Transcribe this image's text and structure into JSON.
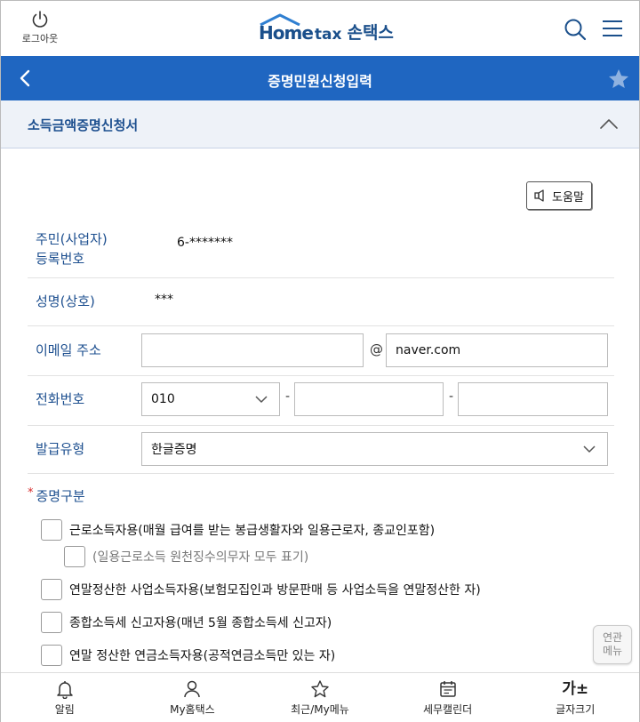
{
  "header": {
    "logout_label": "로그아웃",
    "logo_home": "Home",
    "logo_tax": "tax",
    "logo_korean": "손택스",
    "brand_color": "#1a4f8b",
    "accent_color": "#f29a1f"
  },
  "titlebar": {
    "title": "증명민원신청입력",
    "background": "#1f66c1"
  },
  "section": {
    "title": "소득금액증명신청서"
  },
  "help_button": {
    "label": "도움말"
  },
  "form": {
    "resident_number": {
      "label_line1": "주민(사업자)",
      "label_line2": "등록번호",
      "value": "6-*******"
    },
    "name": {
      "label": "성명(상호)",
      "value": "***"
    },
    "email": {
      "label": "이메일 주소",
      "local_value": "",
      "at": "@",
      "domain_value": "naver.com"
    },
    "phone": {
      "label": "전화번호",
      "prefix_value": "010",
      "dash": "-",
      "middle_value": "",
      "last_value": ""
    },
    "issue_type": {
      "label": "발급유형",
      "value": "한글증명"
    }
  },
  "proof_type": {
    "required_mark": "*",
    "label": "증명구분",
    "options": [
      {
        "label": "근로소득자용(매월 급여를 받는 봉급생활자와 일용근로자, 종교인포함)"
      },
      {
        "label": "(일용근로소득 원천징수의무자 모두 표기)"
      },
      {
        "label": "연말정산한 사업소득자용(보험모집인과 방문판매 등 사업소득을 연말정산한 자)"
      },
      {
        "label": "종합소득세 신고자용(매년 5월 종합소득세 신고자)"
      },
      {
        "label": "연말 정산한 연금소득자용(공적연금소득만 있는 자)"
      }
    ]
  },
  "related_menu": {
    "line1": "연관",
    "line2": "메뉴"
  },
  "bottom_nav": {
    "items": [
      {
        "label": "알림",
        "icon": "bell-icon"
      },
      {
        "label": "My홈택스",
        "icon": "person-icon"
      },
      {
        "label": "최근/My메뉴",
        "icon": "star-icon"
      },
      {
        "label": "세무캘린더",
        "icon": "calendar-icon"
      },
      {
        "label": "글자크기",
        "glyph": "가±",
        "icon": "font-size-icon"
      }
    ]
  }
}
